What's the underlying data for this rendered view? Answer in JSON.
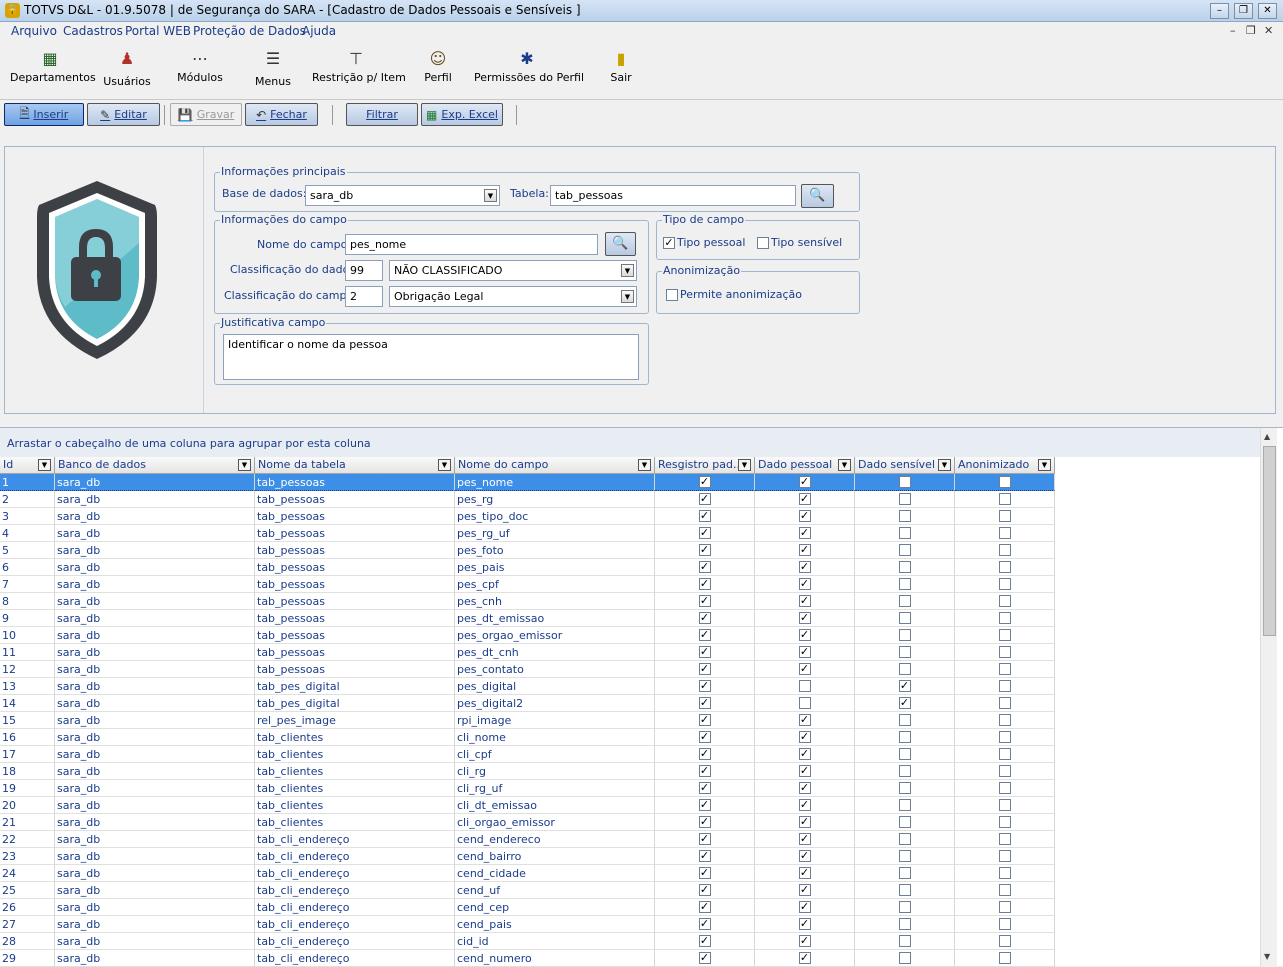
{
  "window": {
    "title": "TOTVS D&L - 01.9.5078 | de Segurança do SARA - [Cadastro de Dados Pessoais e Sensíveis ]",
    "app_icon": "lock-app-icon"
  },
  "menu": [
    "Arquivo",
    "Cadastros",
    "Portal WEB",
    "Proteção de Dados",
    "Ajuda"
  ],
  "toolbar_main": [
    {
      "label": "Departamentos",
      "icon": "grid-icon"
    },
    {
      "label": "Usuários",
      "icon": "users-icon"
    },
    {
      "label": "Módulos",
      "icon": "modules-icon"
    },
    {
      "label": "Menus",
      "icon": "menu-icon"
    },
    {
      "label": "Restrição p/ Item",
      "icon": "restriction-icon"
    },
    {
      "label": "Perfil",
      "icon": "profile-icon"
    },
    {
      "label": "Permissões do Perfil",
      "icon": "permissions-icon"
    },
    {
      "label": "Sair",
      "icon": "exit-icon"
    }
  ],
  "toolbar_actions": {
    "inserir": "Inserir",
    "editar": "Editar",
    "gravar": "Gravar",
    "fechar": "Fechar",
    "filtrar": "Filtrar",
    "exp_excel": "Exp. Excel"
  },
  "form": {
    "info_principais": {
      "legend": "Informações principais",
      "base_label": "Base de dados:",
      "base_value": "sara_db",
      "tabela_label": "Tabela:",
      "tabela_value": "tab_pessoas"
    },
    "info_campo": {
      "legend": "Informações do campo",
      "nome_label": "Nome do campo:",
      "nome_value": "pes_nome",
      "class_dado_label": "Classificação do dado:",
      "class_dado_code": "99",
      "class_dado_value": "NÃO CLASSIFICADO",
      "class_campo_label": "Classificação do campo:",
      "class_campo_code": "2",
      "class_campo_value": "Obrigação Legal"
    },
    "tipo_campo": {
      "legend": "Tipo de campo",
      "pessoal_label": "Tipo pessoal",
      "pessoal_checked": true,
      "sensivel_label": "Tipo sensível",
      "sensivel_checked": false
    },
    "anonimizacao": {
      "legend": "Anonimização",
      "permite_label": "Permite anonimização",
      "permite_checked": false
    },
    "justificativa": {
      "legend": "Justificativa campo",
      "text": "Identificar o nome da pessoa"
    }
  },
  "grid": {
    "group_hint": "Arrastar o cabeçalho de uma coluna para agrupar por esta coluna",
    "columns": [
      "Id",
      "Banco de dados",
      "Nome da tabela",
      "Nome do campo",
      "Resgistro pad...",
      "Dado pessoal",
      "Dado sensível",
      "Anonimizado"
    ],
    "rows": [
      [
        "1",
        "sara_db",
        "tab_pessoas",
        "pes_nome",
        true,
        true,
        false,
        false
      ],
      [
        "2",
        "sara_db",
        "tab_pessoas",
        "pes_rg",
        true,
        true,
        false,
        false
      ],
      [
        "3",
        "sara_db",
        "tab_pessoas",
        "pes_tipo_doc",
        true,
        true,
        false,
        false
      ],
      [
        "4",
        "sara_db",
        "tab_pessoas",
        "pes_rg_uf",
        true,
        true,
        false,
        false
      ],
      [
        "5",
        "sara_db",
        "tab_pessoas",
        "pes_foto",
        true,
        true,
        false,
        false
      ],
      [
        "6",
        "sara_db",
        "tab_pessoas",
        "pes_pais",
        true,
        true,
        false,
        false
      ],
      [
        "7",
        "sara_db",
        "tab_pessoas",
        "pes_cpf",
        true,
        true,
        false,
        false
      ],
      [
        "8",
        "sara_db",
        "tab_pessoas",
        "pes_cnh",
        true,
        true,
        false,
        false
      ],
      [
        "9",
        "sara_db",
        "tab_pessoas",
        "pes_dt_emissao",
        true,
        true,
        false,
        false
      ],
      [
        "10",
        "sara_db",
        "tab_pessoas",
        "pes_orgao_emissor",
        true,
        true,
        false,
        false
      ],
      [
        "11",
        "sara_db",
        "tab_pessoas",
        "pes_dt_cnh",
        true,
        true,
        false,
        false
      ],
      [
        "12",
        "sara_db",
        "tab_pessoas",
        "pes_contato",
        true,
        true,
        false,
        false
      ],
      [
        "13",
        "sara_db",
        "tab_pes_digital",
        "pes_digital",
        true,
        false,
        true,
        false
      ],
      [
        "14",
        "sara_db",
        "tab_pes_digital",
        "pes_digital2",
        true,
        false,
        true,
        false
      ],
      [
        "15",
        "sara_db",
        "rel_pes_image",
        "rpi_image",
        true,
        true,
        false,
        false
      ],
      [
        "16",
        "sara_db",
        "tab_clientes",
        "cli_nome",
        true,
        true,
        false,
        false
      ],
      [
        "17",
        "sara_db",
        "tab_clientes",
        "cli_cpf",
        true,
        true,
        false,
        false
      ],
      [
        "18",
        "sara_db",
        "tab_clientes",
        "cli_rg",
        true,
        true,
        false,
        false
      ],
      [
        "19",
        "sara_db",
        "tab_clientes",
        "cli_rg_uf",
        true,
        true,
        false,
        false
      ],
      [
        "20",
        "sara_db",
        "tab_clientes",
        "cli_dt_emissao",
        true,
        true,
        false,
        false
      ],
      [
        "21",
        "sara_db",
        "tab_clientes",
        "cli_orgao_emissor",
        true,
        true,
        false,
        false
      ],
      [
        "22",
        "sara_db",
        "tab_cli_endereço",
        "cend_endereco",
        true,
        true,
        false,
        false
      ],
      [
        "23",
        "sara_db",
        "tab_cli_endereço",
        "cend_bairro",
        true,
        true,
        false,
        false
      ],
      [
        "24",
        "sara_db",
        "tab_cli_endereço",
        "cend_cidade",
        true,
        true,
        false,
        false
      ],
      [
        "25",
        "sara_db",
        "tab_cli_endereço",
        "cend_uf",
        true,
        true,
        false,
        false
      ],
      [
        "26",
        "sara_db",
        "tab_cli_endereço",
        "cend_cep",
        true,
        true,
        false,
        false
      ],
      [
        "27",
        "sara_db",
        "tab_cli_endereço",
        "cend_pais",
        true,
        true,
        false,
        false
      ],
      [
        "28",
        "sara_db",
        "tab_cli_endereço",
        "cid_id",
        true,
        true,
        false,
        false
      ],
      [
        "29",
        "sara_db",
        "tab_cli_endereço",
        "cend_numero",
        true,
        true,
        false,
        false
      ]
    ],
    "selected_row": 0
  },
  "colors": {
    "accent": "#3d8ee6",
    "label_blue": "#1a3c8a",
    "shield_teal": "#5dbcc7",
    "shield_dark": "#3d4145"
  }
}
